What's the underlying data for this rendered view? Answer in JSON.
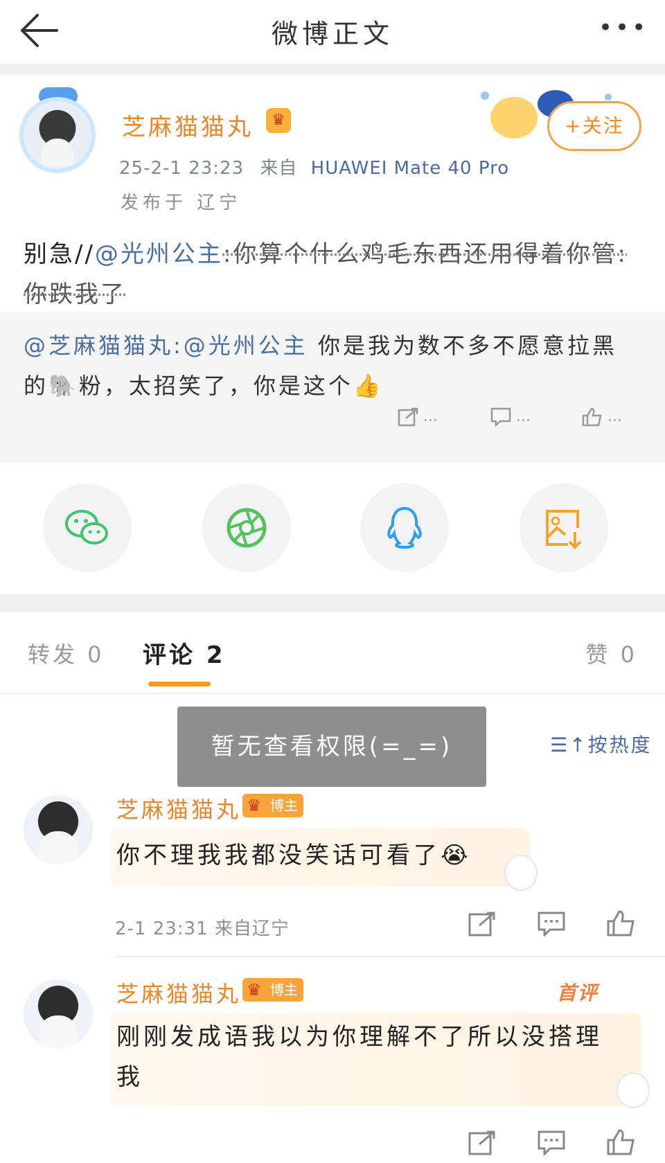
{
  "header": {
    "title": "微博正文",
    "more_label": "•••"
  },
  "post": {
    "author": "芝麻猫猫丸",
    "time": "25-2-1 23:23",
    "from_label": "来自",
    "device": "HUAWEI Mate 40 Pro",
    "location": "发布于 辽宁",
    "follow_label": "+关注",
    "text_prefix": "别急//",
    "text_mention": "@光州公主",
    "text_scribble": ":你算个什么鸡毛东西还用得着你管:",
    "text_line2": "你跌我了"
  },
  "retweet": {
    "author_mention": "@芝麻猫猫丸:",
    "mention2": "@光州公主",
    "text1": " 你是我为数不多不愿意拉黑",
    "text2": "的🐘粉，太招笑了，你是这个👍",
    "share_count": "...",
    "comment_count": "...",
    "like_count": "..."
  },
  "share_targets": [
    "wechat-icon",
    "moments-icon",
    "qq-icon",
    "save-image-icon"
  ],
  "tabs": {
    "repost": "转发 0",
    "comment": "评论 2",
    "like": "赞 0"
  },
  "toast": "暂无查看权限(=_=)",
  "sort_label": "按热度",
  "comments": [
    {
      "author": "芝麻猫猫丸",
      "badge": "博主",
      "text": "你不理我我都没笑话可看了😭",
      "meta": "2-1 23:31 来自辽宁"
    },
    {
      "author": "芝麻猫猫丸",
      "badge": "博主",
      "tag": "首评",
      "text": "刚刚发成语我以为你理解不了所以没搭理我",
      "meta": ""
    }
  ],
  "colors": {
    "accent": "#e8862b",
    "link": "#4a6f9f",
    "tab_underline": "#f59b1c"
  }
}
